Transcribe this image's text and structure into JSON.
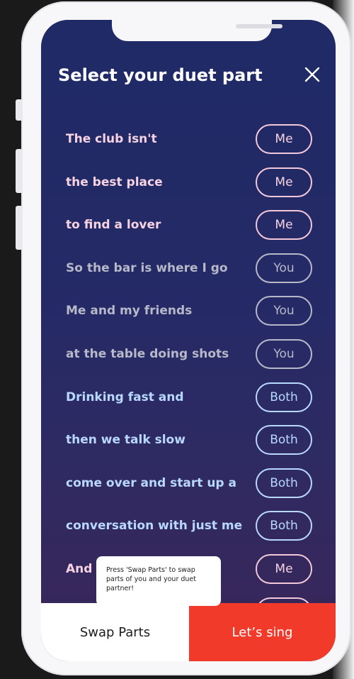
{
  "header": {
    "title": "Select your duet part"
  },
  "lines": [
    {
      "text": "The club isn't",
      "part": "Me",
      "kind": "me"
    },
    {
      "text": "the best place",
      "part": "Me",
      "kind": "me"
    },
    {
      "text": "to find a lover",
      "part": "Me",
      "kind": "me"
    },
    {
      "text": "So the bar is where I go",
      "part": "You",
      "kind": "you"
    },
    {
      "text": "Me and my friends",
      "part": "You",
      "kind": "you"
    },
    {
      "text": "at the table doing shots",
      "part": "You",
      "kind": "you"
    },
    {
      "text": "Drinking fast and",
      "part": "Both",
      "kind": "both"
    },
    {
      "text": "then we talk slow",
      "part": "Both",
      "kind": "both"
    },
    {
      "text": "come over and start up a",
      "part": "Both",
      "kind": "both"
    },
    {
      "text": "conversation with just me",
      "part": "Both",
      "kind": "both"
    },
    {
      "text": "And t",
      "part": "Me",
      "kind": "me"
    }
  ],
  "tooltip": {
    "text": "Press 'Swap Parts' to swap parts of you and your duet partner!"
  },
  "footer": {
    "swap_label": "Swap Parts",
    "sing_label": "Let’s sing"
  },
  "colors": {
    "me": "#f6d3e2",
    "you": "#b7b9c9",
    "both": "#b8d8ff",
    "primary_button": "#f23a2a",
    "background": "#1f2a66"
  },
  "icons": {
    "close": "close-icon"
  }
}
